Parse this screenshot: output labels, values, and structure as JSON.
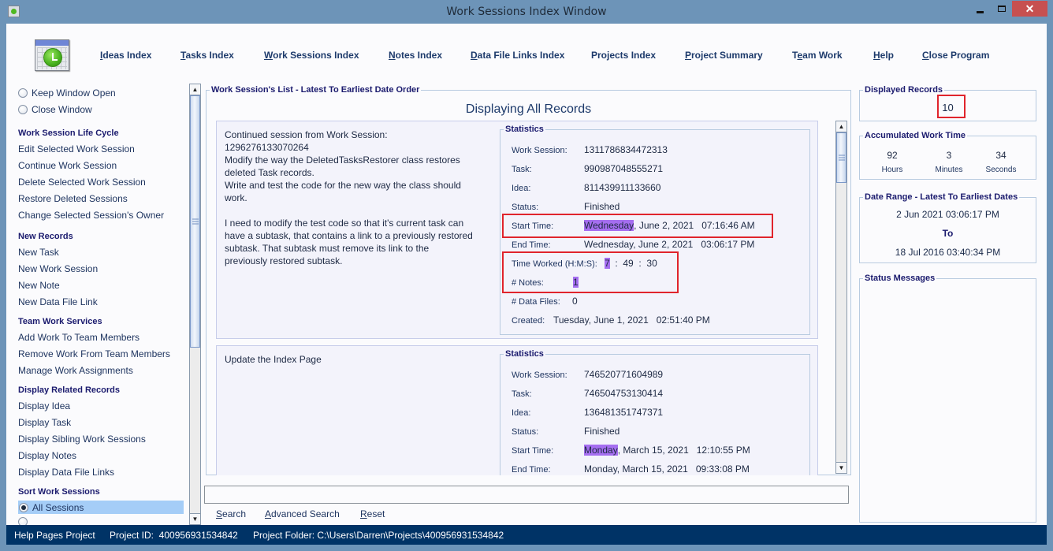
{
  "window": {
    "title": "Work Sessions Index Window",
    "controls": {
      "minimize": "minimize",
      "maximize": "maximize",
      "close": "✕"
    }
  },
  "nav": {
    "items": [
      {
        "label": "Ideas Index",
        "mnemonic": "I"
      },
      {
        "label": "Tasks Index",
        "mnemonic": "T"
      },
      {
        "label": "Work Sessions Index",
        "mnemonic": "W"
      },
      {
        "label": "Notes Index",
        "mnemonic": "N"
      },
      {
        "label": "Data File Links Index",
        "mnemonic": "D"
      },
      {
        "label": "Projects Index",
        "mnemonic": ""
      },
      {
        "label": "Project Summary",
        "mnemonic": "P"
      },
      {
        "label": "Team Work",
        "mnemonic": "e"
      },
      {
        "label": "Help",
        "mnemonic": "H"
      },
      {
        "label": "Close Program",
        "mnemonic": "C"
      }
    ]
  },
  "left_panel": {
    "window_options": [
      {
        "label": "Keep Window Open",
        "checked": false
      },
      {
        "label": "Close Window",
        "checked": false
      }
    ],
    "sections": [
      {
        "title": "Work Session Life Cycle",
        "items": [
          "Edit Selected Work Session",
          "Continue Work Session",
          "Delete Selected Work Session",
          "Restore Deleted Sessions",
          "Change Selected Session's Owner"
        ]
      },
      {
        "title": "New Records",
        "items": [
          "New Task",
          "New Work Session",
          "New Note",
          "New Data File Link"
        ]
      },
      {
        "title": "Team Work Services",
        "items": [
          "Add Work To Team Members",
          "Remove Work From Team Members",
          "Manage Work Assignments"
        ]
      },
      {
        "title": "Display Related Records",
        "items": [
          "Display Idea",
          "Display Task",
          "Display Sibling Work Sessions",
          "Display Notes",
          "Display Data File Links"
        ]
      }
    ],
    "sort": {
      "title": "Sort Work Sessions",
      "selected": "All Sessions"
    }
  },
  "center": {
    "list_title": "Work Session's List - Latest To Earliest Date Order",
    "displaying": "Displaying All Records",
    "stats_title": "Statistics",
    "labels": {
      "work_session": "Work Session:",
      "task": "Task:",
      "idea": "Idea:",
      "status": "Status:",
      "start_time": "Start Time:",
      "end_time": "End Time:",
      "time_worked": "Time Worked (H:M:S):",
      "notes": "# Notes:",
      "data_files": "# Data Files:",
      "created": "Created:"
    },
    "records": [
      {
        "description": "Continued session from Work Session:\n1296276133070264\nModify the way the DeletedTasksRestorer class restores\ndeleted Task records.\nWrite and test the code for the new way the class should\nwork.\n\nI need to modify the test code so that it's current task can\nhave a subtask, that contains a link to a previously restored\nsubtask. That subtask must remove its link to the\npreviously restored subtask.",
        "work_session": "1311786834472313",
        "task": "990987048555271",
        "idea": "811439911133660",
        "status": "Finished",
        "start_day": "Wednesday",
        "start_rest": ", June 2, 2021   07:16:46 AM",
        "end_time": "Wednesday, June 2, 2021   03:06:17 PM",
        "hours": "7",
        "minutes": "49",
        "seconds": "30",
        "notes": "1",
        "data_files": "0",
        "created": "Tuesday, June 1, 2021   02:51:40 PM"
      },
      {
        "description": "Update the Index Page",
        "work_session": "746520771604989",
        "task": "746504753130414",
        "idea": "136481351747371",
        "status": "Finished",
        "start_day": "Monday",
        "start_rest": ", March 15, 2021   12:10:55 PM",
        "end_time": "Monday, March 15, 2021   09:33:08 PM"
      }
    ],
    "search": {
      "value": "",
      "buttons": [
        {
          "label": "Search",
          "mnemonic": "S"
        },
        {
          "label": "Advanced Search",
          "mnemonic": "A"
        },
        {
          "label": "Reset",
          "mnemonic": "R"
        }
      ]
    }
  },
  "right_panel": {
    "displayed_records": {
      "title": "Displayed Records",
      "value": "10"
    },
    "accumulated": {
      "title": "Accumulated Work Time",
      "hours": "92",
      "hours_label": "Hours",
      "minutes": "3",
      "minutes_label": "Minutes",
      "seconds": "34",
      "seconds_label": "Seconds"
    },
    "date_range": {
      "title": "Date Range - Latest To Earliest Dates",
      "latest": "2 Jun 2021  03:06:17 PM",
      "to": "To",
      "earliest": "18 Jul 2016  03:40:34 PM"
    },
    "status_messages": {
      "title": "Status Messages",
      "text": ""
    }
  },
  "statusbar": {
    "project_name": "Help Pages Project",
    "project_id": "Project ID:  400956931534842",
    "project_folder": "Project Folder: C:\\Users\\Darren\\Projects\\400956931534842"
  },
  "colors": {
    "titlebar": "#6d94b8",
    "statusbar": "#003366",
    "highlight": "#a56ef0",
    "annotation": "#e0242c",
    "selection": "#a5cdf7",
    "close_button": "#c75050"
  }
}
